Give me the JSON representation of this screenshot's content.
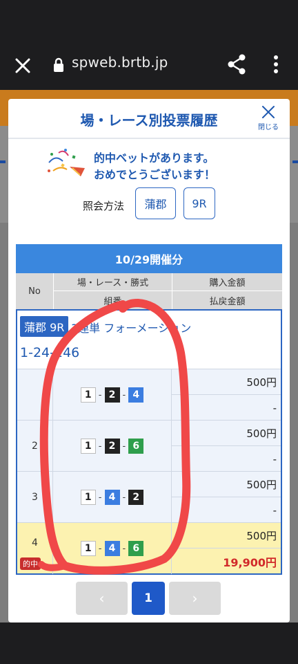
{
  "browser": {
    "url": "spweb.brtb.jp"
  },
  "modal": {
    "title": "場・レース別投票履歴",
    "close_label": "閉じる",
    "congrats_line1": "的中ベットがあります。",
    "congrats_line2": "おめでとうございます！",
    "query_label": "照会方法",
    "query_venue": "蒲郡",
    "query_race": "9R"
  },
  "table": {
    "date_label": "10/29開催分",
    "headers": {
      "no": "No",
      "venue_race_type": "場・レース・勝式",
      "purchase_amount": "購入金額",
      "combination": "組番",
      "payout_amount": "払戻金額"
    },
    "group": {
      "venue_race": "蒲郡 9R",
      "bet_type": "3連単 フォーメーション",
      "formation": "1-24-246"
    },
    "rows": [
      {
        "no": "",
        "combo": [
          "1",
          "2",
          "4"
        ],
        "purchase": "500円",
        "payout": "-",
        "hit": false
      },
      {
        "no": "2",
        "combo": [
          "1",
          "2",
          "6"
        ],
        "purchase": "500円",
        "payout": "-",
        "hit": false
      },
      {
        "no": "3",
        "combo": [
          "1",
          "4",
          "2"
        ],
        "purchase": "500円",
        "payout": "-",
        "hit": false
      },
      {
        "no": "4",
        "combo": [
          "1",
          "4",
          "6"
        ],
        "purchase": "500円",
        "payout": "19,900円",
        "hit": true,
        "hit_label": "的中"
      }
    ]
  },
  "pager": {
    "prev": "‹",
    "current": "1",
    "next": "›"
  },
  "colors": {
    "accent_blue": "#1f59b0",
    "date_bar": "#3a87de",
    "hit_row": "#fcf2b0",
    "win_red": "#d12a2a"
  }
}
